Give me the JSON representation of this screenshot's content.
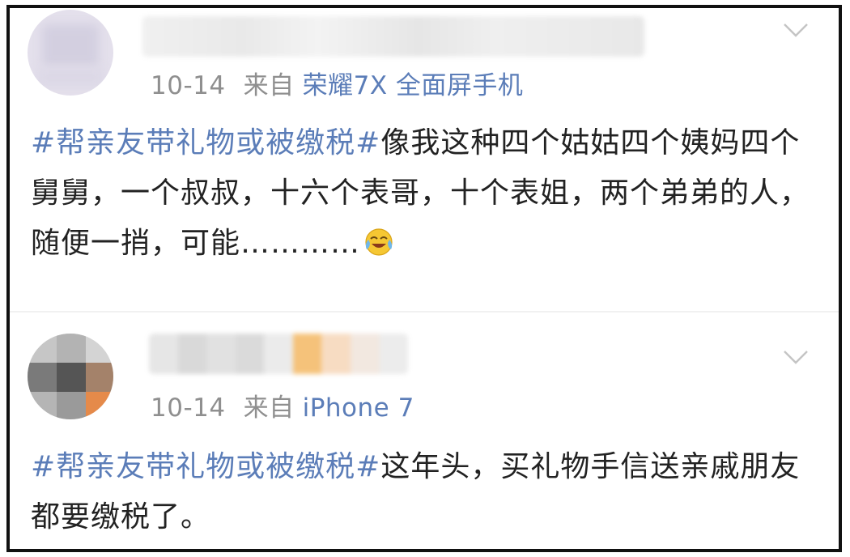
{
  "posts": [
    {
      "date": "10-14",
      "via": "来自",
      "device": "荣耀7X 全面屏手机",
      "hashtag": "#帮亲友带礼物或被缴税#",
      "text": "像我这种四个姑姑四个姨妈四个舅舅，一个叔叔，十六个表哥，十个表姐，两个弟弟的人，随便一捎，可能…………",
      "emoji": "laughing-crying-emoji"
    },
    {
      "date": "10-14",
      "via": "来自",
      "device": "iPhone 7",
      "hashtag": "#帮亲友带礼物或被缴税#",
      "text": "这年头，买礼物手信送亲戚朋友都要缴税了。"
    }
  ],
  "icons": {
    "expand": "chevron-down-icon"
  },
  "colors": {
    "link": "#5b7db8",
    "meta": "#8f8f8f",
    "text": "#222222",
    "border": "#111111"
  }
}
